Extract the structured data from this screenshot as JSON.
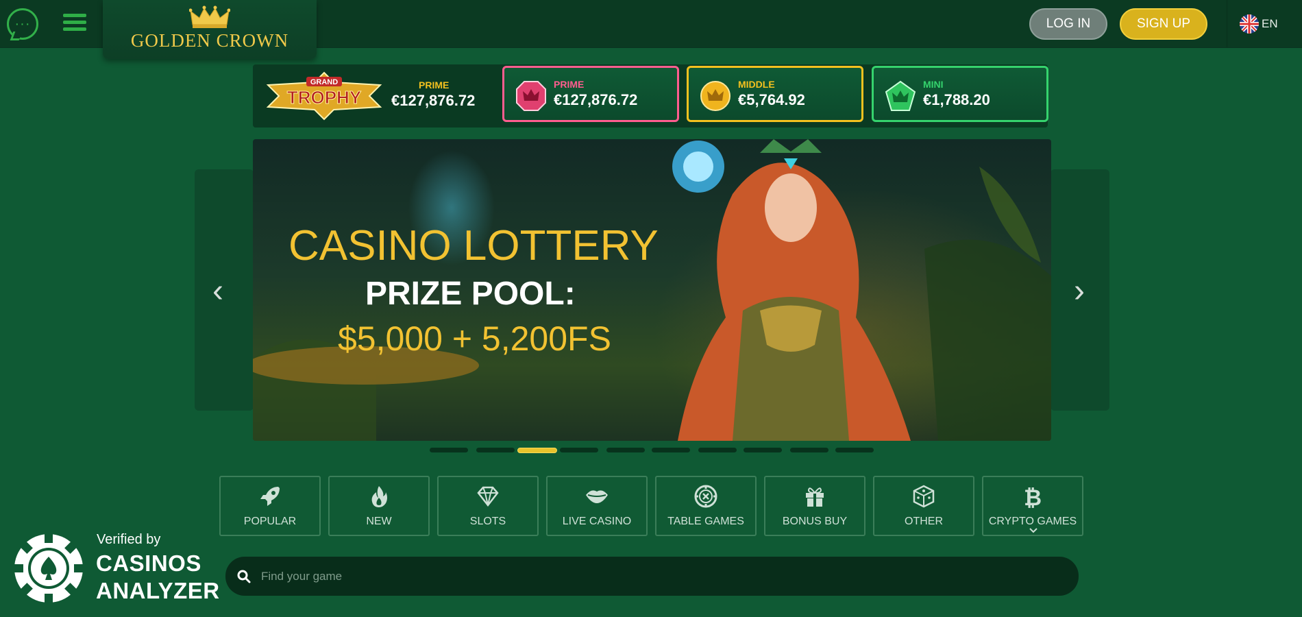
{
  "header": {
    "logo_text": "GOLDEN CROWN",
    "login_label": "LOG IN",
    "signup_label": "SIGN UP",
    "language": "EN"
  },
  "jackpots": {
    "grand_logo_text": "GRAND TROPHY",
    "items": [
      {
        "label": "PRIME",
        "value": "€127,876.72",
        "color": "#f3c11f"
      },
      {
        "label": "PRIME",
        "value": "€127,876.72",
        "color": "#ff5d8f",
        "icon": "ruby-crown-icon"
      },
      {
        "label": "MIDDLE",
        "value": "€5,764.92",
        "color": "#f3c11f",
        "icon": "gold-crown-icon"
      },
      {
        "label": "MINI",
        "value": "€1,788.20",
        "color": "#35d36d",
        "icon": "emerald-crown-icon"
      }
    ]
  },
  "banner": {
    "title": "CASINO LOTTERY",
    "subtitle": "PRIZE POOL:",
    "prize": "$5,000 + 5,200FS",
    "active_slide": 3,
    "slide_count": 10
  },
  "categories": [
    {
      "label": "POPULAR",
      "icon": "rocket-icon"
    },
    {
      "label": "NEW",
      "icon": "flame-icon"
    },
    {
      "label": "SLOTS",
      "icon": "diamond-icon"
    },
    {
      "label": "LIVE CASINO",
      "icon": "lips-icon"
    },
    {
      "label": "TABLE GAMES",
      "icon": "chip-icon"
    },
    {
      "label": "BONUS BUY",
      "icon": "gift-icon"
    },
    {
      "label": "OTHER",
      "icon": "dice-icon"
    },
    {
      "label": "CRYPTO GAMES",
      "icon": "bitcoin-icon"
    }
  ],
  "search": {
    "placeholder": "Find your game"
  },
  "badge": {
    "small": "Verified by",
    "line1": "CASINOS",
    "line2": "ANALYZER"
  },
  "colors": {
    "accent_gold": "#f2c232",
    "bg": "#0f5a34",
    "header": "#0b3a22"
  }
}
